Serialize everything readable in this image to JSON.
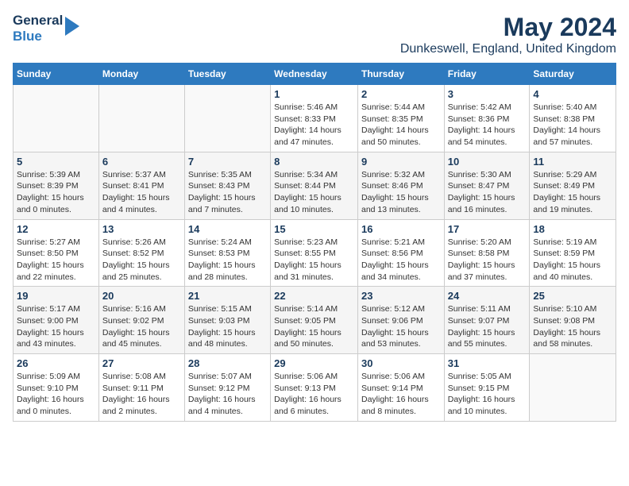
{
  "header": {
    "logo_line1": "General",
    "logo_line2": "Blue",
    "month_title": "May 2024",
    "location": "Dunkeswell, England, United Kingdom"
  },
  "days_of_week": [
    "Sunday",
    "Monday",
    "Tuesday",
    "Wednesday",
    "Thursday",
    "Friday",
    "Saturday"
  ],
  "weeks": [
    [
      {
        "day": "",
        "info": ""
      },
      {
        "day": "",
        "info": ""
      },
      {
        "day": "",
        "info": ""
      },
      {
        "day": "1",
        "info": "Sunrise: 5:46 AM\nSunset: 8:33 PM\nDaylight: 14 hours\nand 47 minutes."
      },
      {
        "day": "2",
        "info": "Sunrise: 5:44 AM\nSunset: 8:35 PM\nDaylight: 14 hours\nand 50 minutes."
      },
      {
        "day": "3",
        "info": "Sunrise: 5:42 AM\nSunset: 8:36 PM\nDaylight: 14 hours\nand 54 minutes."
      },
      {
        "day": "4",
        "info": "Sunrise: 5:40 AM\nSunset: 8:38 PM\nDaylight: 14 hours\nand 57 minutes."
      }
    ],
    [
      {
        "day": "5",
        "info": "Sunrise: 5:39 AM\nSunset: 8:39 PM\nDaylight: 15 hours\nand 0 minutes."
      },
      {
        "day": "6",
        "info": "Sunrise: 5:37 AM\nSunset: 8:41 PM\nDaylight: 15 hours\nand 4 minutes."
      },
      {
        "day": "7",
        "info": "Sunrise: 5:35 AM\nSunset: 8:43 PM\nDaylight: 15 hours\nand 7 minutes."
      },
      {
        "day": "8",
        "info": "Sunrise: 5:34 AM\nSunset: 8:44 PM\nDaylight: 15 hours\nand 10 minutes."
      },
      {
        "day": "9",
        "info": "Sunrise: 5:32 AM\nSunset: 8:46 PM\nDaylight: 15 hours\nand 13 minutes."
      },
      {
        "day": "10",
        "info": "Sunrise: 5:30 AM\nSunset: 8:47 PM\nDaylight: 15 hours\nand 16 minutes."
      },
      {
        "day": "11",
        "info": "Sunrise: 5:29 AM\nSunset: 8:49 PM\nDaylight: 15 hours\nand 19 minutes."
      }
    ],
    [
      {
        "day": "12",
        "info": "Sunrise: 5:27 AM\nSunset: 8:50 PM\nDaylight: 15 hours\nand 22 minutes."
      },
      {
        "day": "13",
        "info": "Sunrise: 5:26 AM\nSunset: 8:52 PM\nDaylight: 15 hours\nand 25 minutes."
      },
      {
        "day": "14",
        "info": "Sunrise: 5:24 AM\nSunset: 8:53 PM\nDaylight: 15 hours\nand 28 minutes."
      },
      {
        "day": "15",
        "info": "Sunrise: 5:23 AM\nSunset: 8:55 PM\nDaylight: 15 hours\nand 31 minutes."
      },
      {
        "day": "16",
        "info": "Sunrise: 5:21 AM\nSunset: 8:56 PM\nDaylight: 15 hours\nand 34 minutes."
      },
      {
        "day": "17",
        "info": "Sunrise: 5:20 AM\nSunset: 8:58 PM\nDaylight: 15 hours\nand 37 minutes."
      },
      {
        "day": "18",
        "info": "Sunrise: 5:19 AM\nSunset: 8:59 PM\nDaylight: 15 hours\nand 40 minutes."
      }
    ],
    [
      {
        "day": "19",
        "info": "Sunrise: 5:17 AM\nSunset: 9:00 PM\nDaylight: 15 hours\nand 43 minutes."
      },
      {
        "day": "20",
        "info": "Sunrise: 5:16 AM\nSunset: 9:02 PM\nDaylight: 15 hours\nand 45 minutes."
      },
      {
        "day": "21",
        "info": "Sunrise: 5:15 AM\nSunset: 9:03 PM\nDaylight: 15 hours\nand 48 minutes."
      },
      {
        "day": "22",
        "info": "Sunrise: 5:14 AM\nSunset: 9:05 PM\nDaylight: 15 hours\nand 50 minutes."
      },
      {
        "day": "23",
        "info": "Sunrise: 5:12 AM\nSunset: 9:06 PM\nDaylight: 15 hours\nand 53 minutes."
      },
      {
        "day": "24",
        "info": "Sunrise: 5:11 AM\nSunset: 9:07 PM\nDaylight: 15 hours\nand 55 minutes."
      },
      {
        "day": "25",
        "info": "Sunrise: 5:10 AM\nSunset: 9:08 PM\nDaylight: 15 hours\nand 58 minutes."
      }
    ],
    [
      {
        "day": "26",
        "info": "Sunrise: 5:09 AM\nSunset: 9:10 PM\nDaylight: 16 hours\nand 0 minutes."
      },
      {
        "day": "27",
        "info": "Sunrise: 5:08 AM\nSunset: 9:11 PM\nDaylight: 16 hours\nand 2 minutes."
      },
      {
        "day": "28",
        "info": "Sunrise: 5:07 AM\nSunset: 9:12 PM\nDaylight: 16 hours\nand 4 minutes."
      },
      {
        "day": "29",
        "info": "Sunrise: 5:06 AM\nSunset: 9:13 PM\nDaylight: 16 hours\nand 6 minutes."
      },
      {
        "day": "30",
        "info": "Sunrise: 5:06 AM\nSunset: 9:14 PM\nDaylight: 16 hours\nand 8 minutes."
      },
      {
        "day": "31",
        "info": "Sunrise: 5:05 AM\nSunset: 9:15 PM\nDaylight: 16 hours\nand 10 minutes."
      },
      {
        "day": "",
        "info": ""
      }
    ]
  ]
}
